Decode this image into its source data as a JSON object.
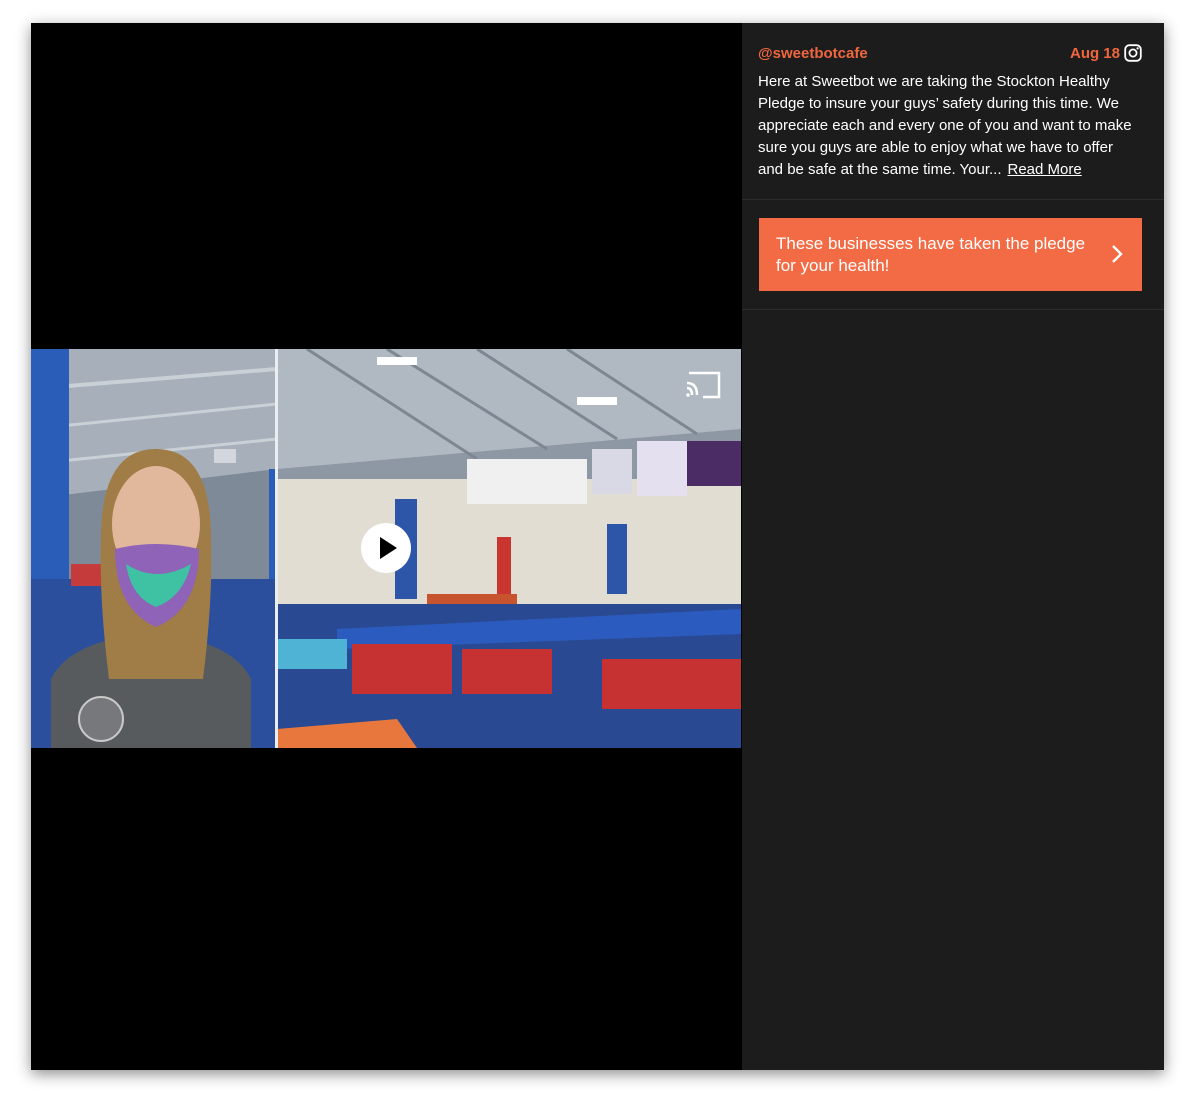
{
  "post": {
    "username": "@sweetbotcafe",
    "date": "Aug 18",
    "caption": "Here at Sweetbot we are taking the Stockton Healthy Pledge to insure your guys’ safety during this time. We appreciate each and every one of you and want to make sure you guys are able to enjoy what we have to offer and be safe at the same time. Your...",
    "read_more": "Read More"
  },
  "pledge_button": {
    "label": "These businesses have taken the pledge for your health!"
  },
  "icons": {
    "social": "instagram-icon",
    "play": "play-icon",
    "cast": "cast-icon",
    "arrow": "chevron-right-icon"
  },
  "colors": {
    "accent": "#f0673f",
    "button_bg": "#f26b45",
    "sidebar_bg": "#1c1c1c",
    "media_bg": "#000000"
  }
}
